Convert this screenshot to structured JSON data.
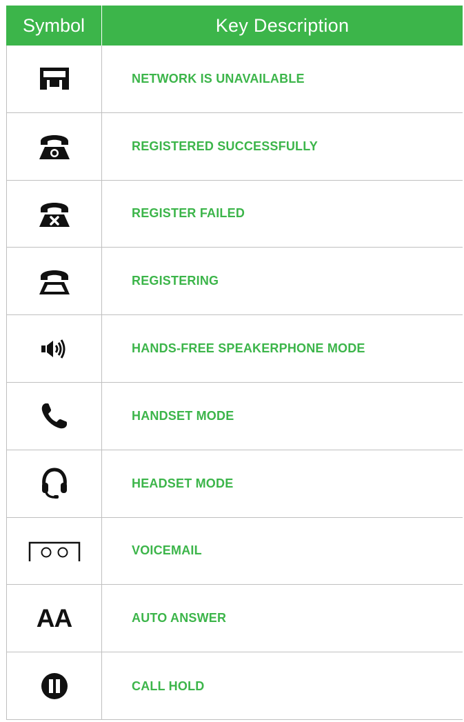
{
  "colors": {
    "accent": "#3cb54a",
    "icon": "#111111",
    "rule": "#bfbfbf"
  },
  "header": {
    "symbol": "Symbol",
    "description": "Key Description"
  },
  "rows": [
    {
      "icon": "network-unavailable-icon",
      "label": "NETWORK IS UNAVAILABLE"
    },
    {
      "icon": "phone-registered-icon",
      "label": "REGISTERED SUCCESSFULLY"
    },
    {
      "icon": "phone-register-failed-icon",
      "label": "REGISTER FAILED"
    },
    {
      "icon": "phone-registering-icon",
      "label": "REGISTERING"
    },
    {
      "icon": "speaker-icon",
      "label": "HANDS-FREE SPEAKERPHONE MODE"
    },
    {
      "icon": "handset-icon",
      "label": "HANDSET MODE"
    },
    {
      "icon": "headset-icon",
      "label": "HEADSET MODE"
    },
    {
      "icon": "voicemail-icon",
      "label": "VOICEMAIL"
    },
    {
      "icon": "auto-answer-icon",
      "label": "AUTO ANSWER",
      "symbol_text": "AA"
    },
    {
      "icon": "call-hold-icon",
      "label": "CALL HOLD"
    }
  ]
}
